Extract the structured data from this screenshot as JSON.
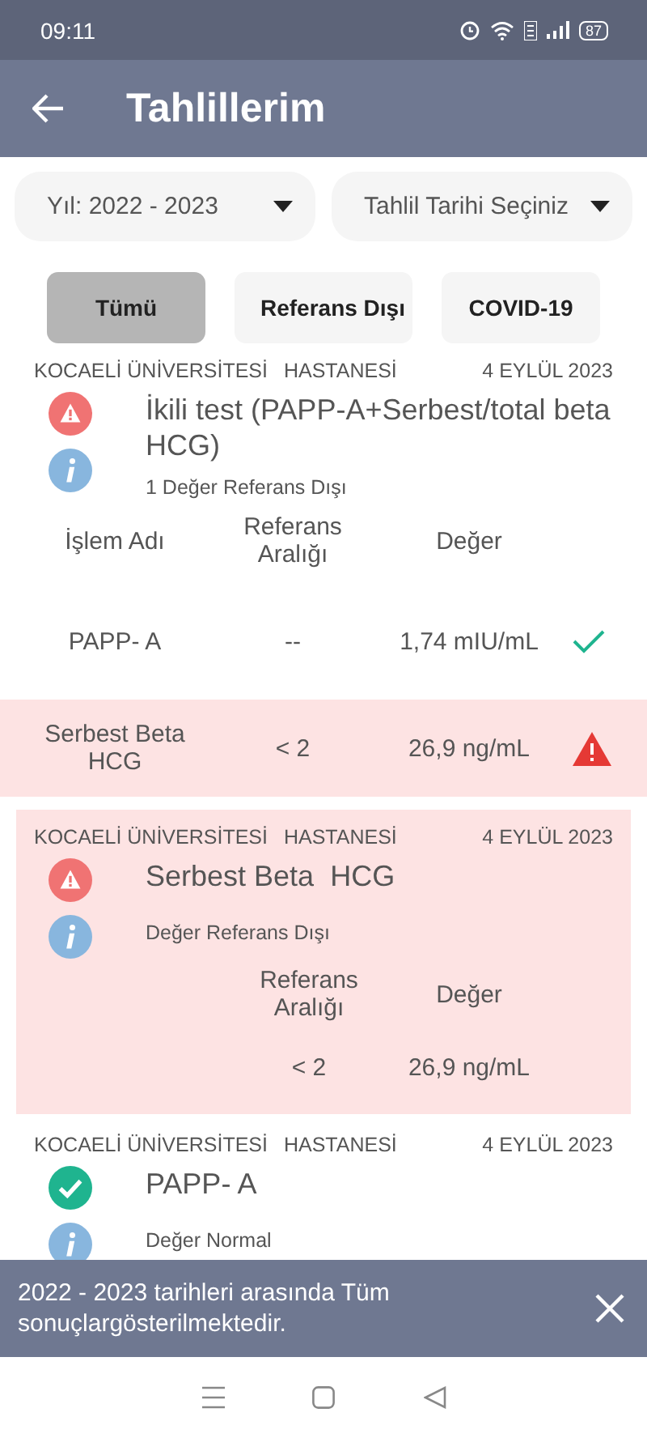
{
  "status_bar": {
    "time": "09:11",
    "battery": "87"
  },
  "app_bar": {
    "title": "Tahlillerim"
  },
  "filters": [
    {
      "label": "Yıl: 2022 - 2023"
    },
    {
      "label": "Tahlil Tarihi Seçiniz"
    }
  ],
  "tabs": [
    {
      "label": "Tümü",
      "selected": true
    },
    {
      "label": "Referans Dışı",
      "selected": false
    },
    {
      "label": "COVID-19",
      "selected": false
    }
  ],
  "results": [
    {
      "hospital": "KOCAELİ ÜNİVERSİTESİ",
      "hospital_2": "HASTANESİ",
      "date": "4 EYLÜL 2023",
      "kind": "warning",
      "highlighted": false,
      "title": "İkili test (PAPP-A+Serbest/total beta HCG)",
      "subtitle": "1 Değer Referans Dışı",
      "table": {
        "columns": {
          "name": "İşlem Adı",
          "range": "Referans Aralığı",
          "value": "Değer"
        },
        "rows": [
          {
            "name": "PAPP- A",
            "range": "--",
            "value": "1,74 mIU/mL",
            "kind": "normal"
          },
          {
            "name": "Serbest Beta HCG",
            "range": "< 2",
            "value": "26,9 ng/mL",
            "kind": "out_of_range"
          }
        ]
      }
    },
    {
      "hospital": "KOCAELİ ÜNİVERSİTESİ",
      "hospital_2": "HASTANESİ",
      "date": "4 EYLÜL 2023",
      "kind": "warning",
      "highlighted": true,
      "title": "Serbest Beta  HCG",
      "subtitle": "Değer Referans Dışı",
      "table": {
        "columns": {
          "range": "Referans Aralığı",
          "value": "Değer"
        },
        "rows": [
          {
            "range": "< 2",
            "value": "26,9 ng/mL"
          }
        ]
      }
    },
    {
      "hospital": "KOCAELİ ÜNİVERSİTESİ",
      "hospital_2": "HASTANESİ",
      "date": "4 EYLÜL 2023",
      "kind": "normal",
      "highlighted": false,
      "title": "PAPP- A",
      "subtitle": "Değer Normal"
    }
  ],
  "snackbar": {
    "message": "2022 - 2023 tarihleri arasında Tüm sonuçlargösterilmektedir."
  }
}
